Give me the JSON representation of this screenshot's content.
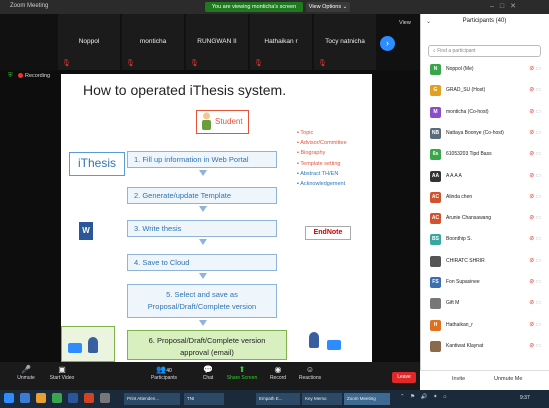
{
  "window": {
    "title": "Zoom Meeting"
  },
  "share_banner": "You are viewing monticha's screen",
  "view_options": "View Options ⌄",
  "view_button": "View",
  "thumbnails": [
    {
      "name": "Noppol"
    },
    {
      "name": "monticha"
    },
    {
      "name": "RUNGWAN II"
    },
    {
      "name": "Hathaikan r"
    },
    {
      "name": "Tocy natnicha"
    }
  ],
  "recording": "Recording",
  "slide": {
    "title": "How to operated iThesis system.",
    "ithesis_label": "iThesis",
    "student_label": "Student",
    "steps": [
      "1. Fill up information in Web Portal",
      "2. Generate/update Template",
      "3. Write thesis",
      "4. Save to Cloud",
      "5. Select and save as",
      "Proposal/Draft/Complete version",
      "6. Proposal/Draft/Complete version",
      "approval (email)"
    ],
    "bullets_red": [
      "Topic",
      "Advisor/Committee",
      "Biography",
      "Template setting"
    ],
    "bullets_blue": [
      "Abstract TH/EN",
      "Acknowledgement"
    ],
    "endnote": "EndNote",
    "word_letter": "W"
  },
  "participants_panel": {
    "title": "Participants (40)",
    "search_placeholder": "Find a participant",
    "invite": "Invite",
    "unmute_me": "Unmute Me",
    "rows": [
      {
        "initials": "N",
        "color": "#3aa64b",
        "name": "Noppol (Me)"
      },
      {
        "initials": "G",
        "color": "#e0a020",
        "name": "GRAD_SU (Host)"
      },
      {
        "initials": "M",
        "color": "#8a4fc7",
        "name": "monticha (Co-host)"
      },
      {
        "initials": "NB",
        "color": "#5a6b7c",
        "name": "Nattaya Boonye (Co-host)"
      },
      {
        "initials": "6s",
        "color": "#3aa64b",
        "name": "61053203 Tipd Bass"
      },
      {
        "initials": "AA",
        "color": "#333333",
        "name": "A A A A"
      },
      {
        "initials": "AC",
        "color": "#d2522d",
        "name": "Alinda chen"
      },
      {
        "initials": "AC",
        "color": "#d2522d",
        "name": "Arunie Chansawang"
      },
      {
        "initials": "BS",
        "color": "#3aa6a0",
        "name": "Boonthip S."
      },
      {
        "initials": "",
        "color": "#555555",
        "name": "CHIRATC SHRIR"
      },
      {
        "initials": "FS",
        "color": "#3a6fb0",
        "name": "Fon Supasinee"
      },
      {
        "initials": "",
        "color": "#777777",
        "name": "Gift M"
      },
      {
        "initials": "H",
        "color": "#e07020",
        "name": "Hathaikan_r"
      },
      {
        "initials": "",
        "color": "#8a6a4a",
        "name": "Kantiwat Klaynat"
      }
    ]
  },
  "toolbar": {
    "unmute": "Unmute",
    "start_video": "Start Video",
    "participants": "Participants",
    "participants_count": "40",
    "chat": "Chat",
    "share_screen": "Share Screen",
    "record": "Record",
    "reactions": "Reactions",
    "leave": "Leave"
  },
  "taskbar": {
    "items": [
      "Print Attenden...",
      "TNI",
      "Empath E...",
      "Key Memo",
      "Zoom Meeting"
    ],
    "clock": "9:37"
  }
}
